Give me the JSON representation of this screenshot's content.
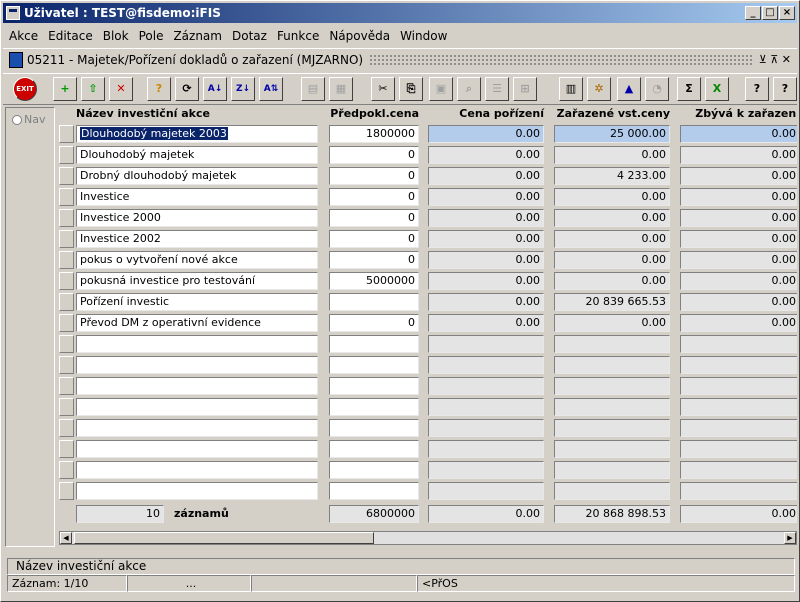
{
  "window": {
    "title": "Uživatel : TEST@fisdemo:iFIS"
  },
  "menu": [
    "Akce",
    "Editace",
    "Blok",
    "Pole",
    "Záznam",
    "Dotaz",
    "Funkce",
    "Nápověda",
    "Window"
  ],
  "form": {
    "title": "05211 - Majetek/Pořízení dokladů o zařazení (MJZARNO)"
  },
  "nav": {
    "label": "Nav"
  },
  "columns": [
    "Název investiční akce",
    "Předpokl.cena",
    "Cena pořízení",
    "Zařazené vst.ceny",
    "Zbývá k zařazení"
  ],
  "rows": [
    {
      "name": "Dlouhodobý majetek 2003",
      "pred": "1800000",
      "cena": "0.00",
      "zar": "25 000.00",
      "zbyva": "0.00"
    },
    {
      "name": "Dlouhodobý majetek",
      "pred": "0",
      "cena": "0.00",
      "zar": "0.00",
      "zbyva": "0.00"
    },
    {
      "name": "Drobný dlouhodobý majetek",
      "pred": "0",
      "cena": "0.00",
      "zar": "4 233.00",
      "zbyva": "0.00"
    },
    {
      "name": "Investice",
      "pred": "0",
      "cena": "0.00",
      "zar": "0.00",
      "zbyva": "0.00"
    },
    {
      "name": "Investice 2000",
      "pred": "0",
      "cena": "0.00",
      "zar": "0.00",
      "zbyva": "0.00"
    },
    {
      "name": "Investice 2002",
      "pred": "0",
      "cena": "0.00",
      "zar": "0.00",
      "zbyva": "0.00"
    },
    {
      "name": "pokus o vytvoření nové akce",
      "pred": "0",
      "cena": "0.00",
      "zar": "0.00",
      "zbyva": "0.00"
    },
    {
      "name": "pokusná investice pro testování",
      "pred": "5000000",
      "cena": "0.00",
      "zar": "0.00",
      "zbyva": "0.00"
    },
    {
      "name": "Pořízení investic",
      "pred": "",
      "cena": "0.00",
      "zar": "20 839 665.53",
      "zbyva": "0.00"
    },
    {
      "name": "Převod DM z operativní evidence",
      "pred": "0",
      "cena": "0.00",
      "zar": "0.00",
      "zbyva": "0.00"
    }
  ],
  "summary": {
    "count": "10",
    "count_label": "záznamů",
    "pred": "6800000",
    "cena": "0.00",
    "zar": "20 868 898.53",
    "zbyva": "0.00"
  },
  "status": {
    "field": "Název investiční akce",
    "record": "Záznam: 1/10",
    "seg2": "...",
    "seg3": "",
    "mode": "<PřOS"
  },
  "colors": {
    "title_start": "#0a246a",
    "title_end": "#a6caf0",
    "selected_cell": "#b3ccec"
  }
}
